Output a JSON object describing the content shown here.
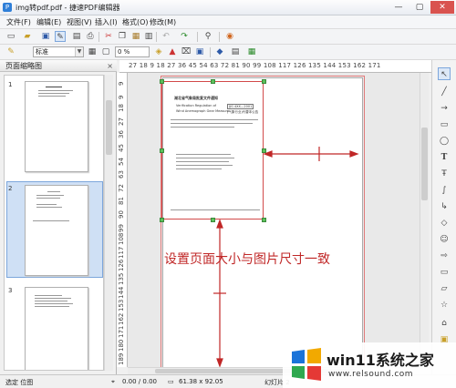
{
  "window": {
    "title": "img转pdf.pdf - 捷速PDF编辑器",
    "minimize_label": "—",
    "maximize_label": "▢",
    "close_label": "✕"
  },
  "menu": [
    "文件(F)",
    "编辑(E)",
    "视图(V)",
    "插入(I)",
    "格式(O)",
    "修改(M)"
  ],
  "toolbar": {
    "style_value": "标准",
    "line_width_value": "0 %"
  },
  "sidebar": {
    "title": "页面缩略图",
    "close_label": "×",
    "pages": [
      {
        "number": "1",
        "selected": false
      },
      {
        "number": "2",
        "selected": true
      },
      {
        "number": "3",
        "selected": false
      }
    ]
  },
  "ruler": {
    "horizontal_labels": "27  18    9    18  27  36  45  54  63  72  81  90  99  108 117 126 135 144 153 162 171",
    "vertical_labels": [
      "9",
      "9",
      "18",
      "27",
      "36",
      "45",
      "54",
      "63",
      "72",
      "81",
      "90",
      "99",
      "108",
      "117",
      "126",
      "135",
      "144",
      "153",
      "162",
      "171",
      "180",
      "189"
    ]
  },
  "document": {
    "heading": "湖北省气象局批复文件通知",
    "sub1": "Verification Regulation of",
    "sub2": "Wind Anemograph Gear Measure",
    "code1": "JJG 4XX—2001",
    "code2": "(气象行业)代替本公告"
  },
  "annotation": {
    "text": "设置页面大小与图片尺寸一致"
  },
  "status": {
    "mode": "选定  位图",
    "position": "0.00 / 0.00",
    "size": "61.38 x 92.05",
    "slide": "幻灯片 2"
  },
  "watermark": {
    "title": "win11系统之家",
    "url": "www.relsound.com"
  },
  "colors": {
    "annotation_red": "#c02727",
    "handle_green": "#5cc15c",
    "selection_blue": "#cfe0f5"
  }
}
